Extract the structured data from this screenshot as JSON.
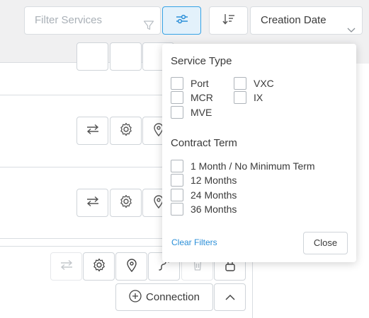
{
  "toolbar": {
    "filter_placeholder": "Filter Services",
    "sort_selected": "Creation Date"
  },
  "actions": {
    "connection_label": "Connection"
  },
  "filter_panel": {
    "service_type_heading": "Service Type",
    "service_types": [
      "Port",
      "MCR",
      "MVE",
      "VXC",
      "IX"
    ],
    "contract_term_heading": "Contract Term",
    "contract_terms": [
      "1 Month / No Minimum Term",
      "12 Months",
      "24 Months",
      "36 Months"
    ],
    "clear_label": "Clear Filters",
    "close_label": "Close"
  },
  "colors": {
    "accent": "#36a3e6",
    "link": "#2b8fd8",
    "toolbar_bg": "#f0f0f1"
  }
}
